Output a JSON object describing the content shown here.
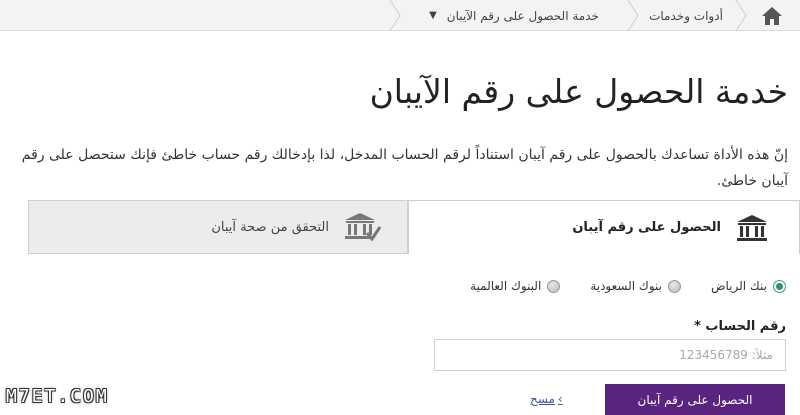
{
  "breadcrumb": {
    "home_icon": "home-icon",
    "items": [
      "أدوات وخدمات",
      "خدمة الحصول على رقم الآيبان"
    ],
    "dropdown_icon": "caret-down-icon"
  },
  "page": {
    "title": "خدمة الحصول على رقم الآيبان",
    "description": "إنّ هذه الأداة تساعدك بالحصول على رقم آيبان استناداً لرقم الحساب المدخل، لذا بإدخالك رقم حساب خاطئ فإنك ستحصل على رقم آيبان خاطئ."
  },
  "tabs": [
    {
      "label": "الحصول على رقم آيبان",
      "icon": "bank-icon",
      "active": true
    },
    {
      "label": "التحقق من صحة آيبان",
      "icon": "bank-check-icon",
      "active": false
    }
  ],
  "banks": {
    "options": [
      "بنك الرياض",
      "بنوك السعودية",
      "البنوك العالمية"
    ],
    "selected": "بنك الرياض"
  },
  "account": {
    "label": "رقم الحساب *",
    "placeholder": "مثلاً: 123456789"
  },
  "actions": {
    "submit_label": "الحصول على رقم آيبان",
    "clear_label": "مسح",
    "clear_icon": "chevron-right-icon"
  },
  "watermark": "M7ET.COM",
  "colors": {
    "primary": "#5b2380",
    "radio_selected": "#2f8f6e",
    "link": "#3b55a0"
  }
}
